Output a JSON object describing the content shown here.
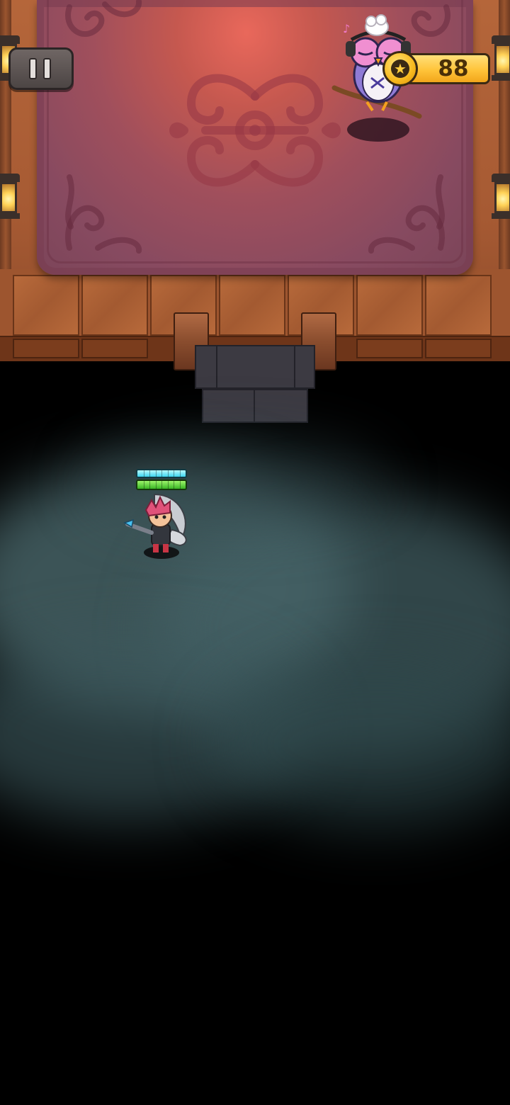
{
  "hud": {
    "pause_icon": "pause-icon",
    "coins": {
      "icon": "star-coin-icon",
      "value": "88"
    }
  },
  "player": {
    "shield_fraction": 1.0,
    "health_fraction": 1.0
  },
  "colors": {
    "carpet_glow": "#e9685b",
    "shield_bar": "#3fd6f0",
    "health_bar": "#3bb625",
    "coin_bar": "#ffc43a",
    "fog": "#5d7f82"
  }
}
